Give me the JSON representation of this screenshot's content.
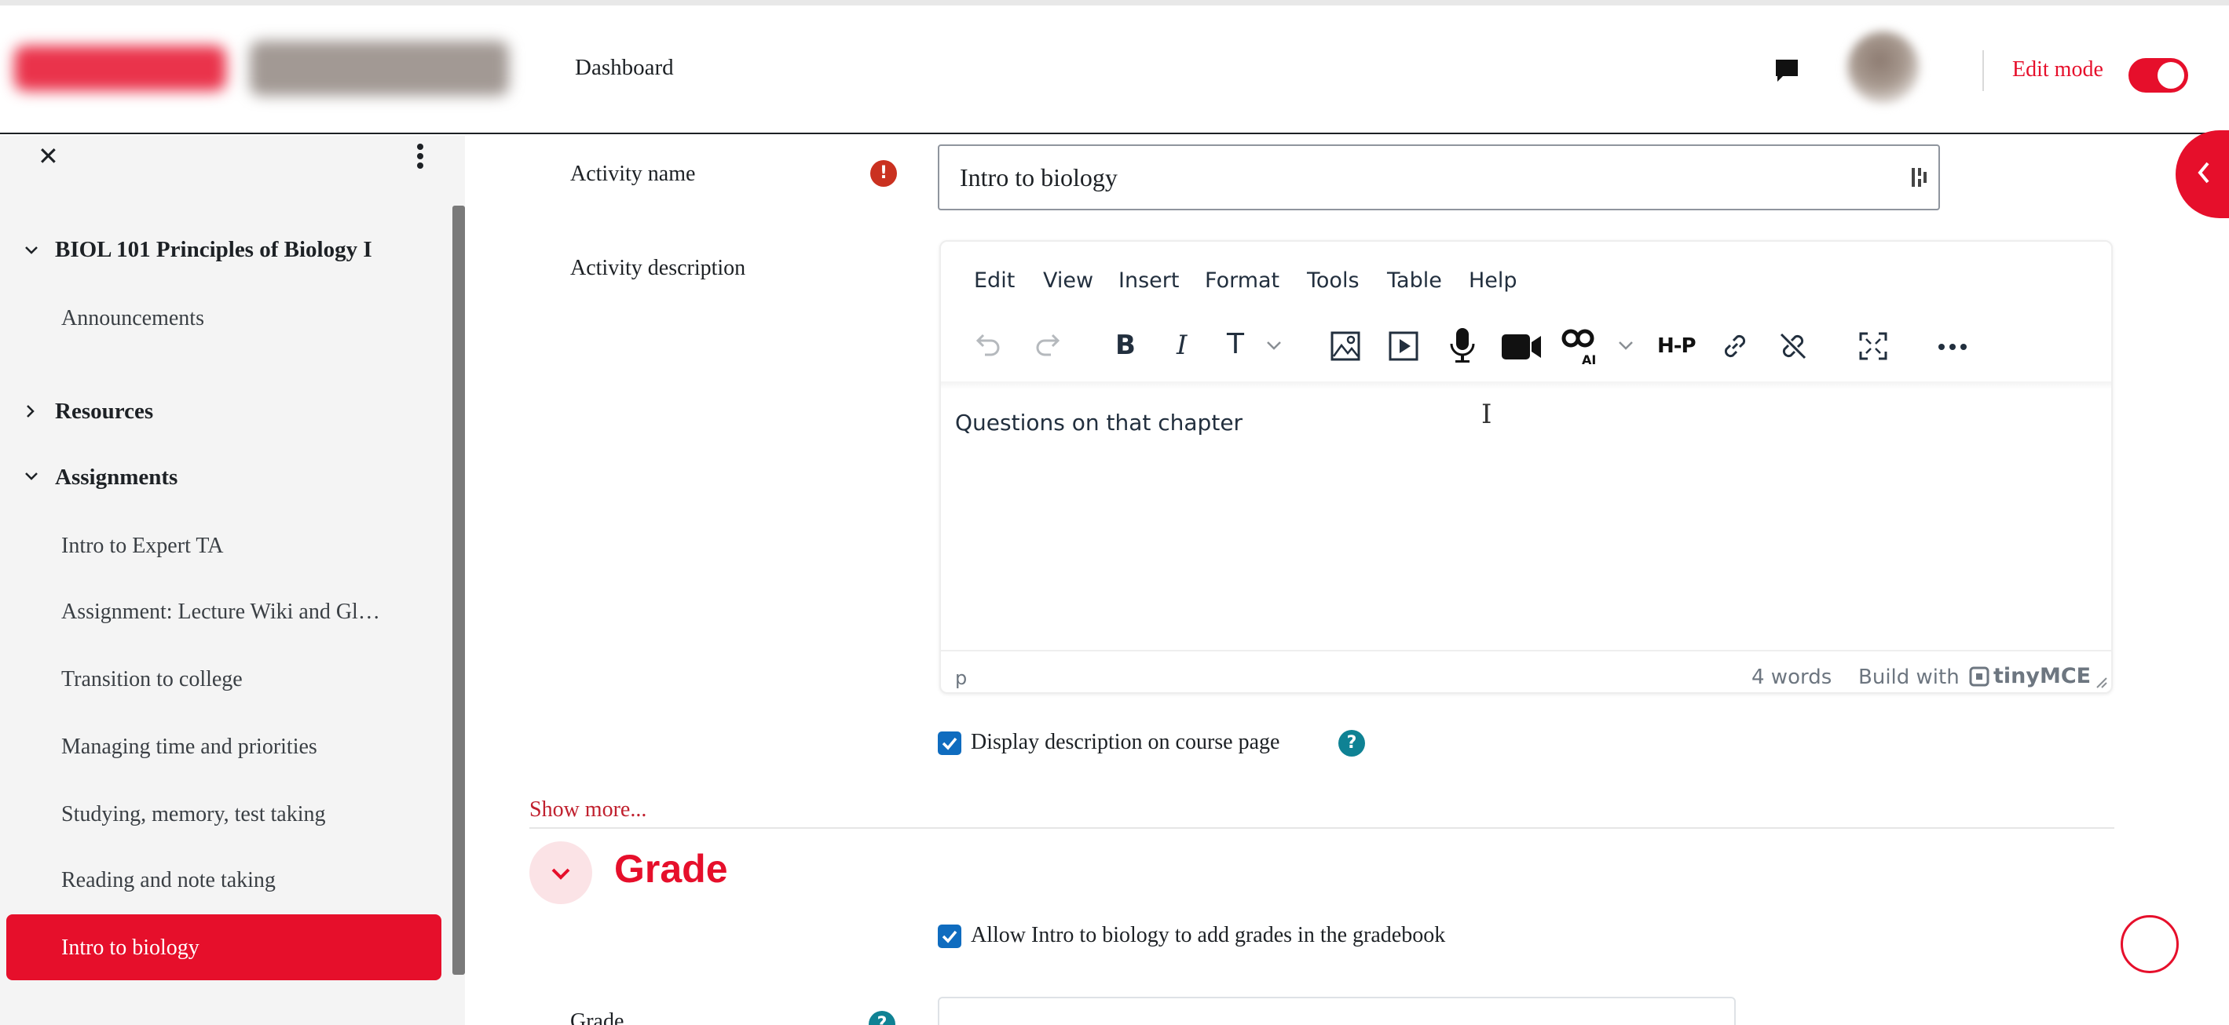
{
  "colors": {
    "brand": "#e60f2b",
    "link": "#c0202e",
    "checkbox": "#0f6cbf",
    "help": "#0f8294",
    "required": "#ca3120"
  },
  "navbar": {
    "dashboard_label": "Dashboard",
    "edit_mode_label": "Edit mode",
    "edit_mode_on": true,
    "icons": [
      "logo",
      "message-icon",
      "avatar"
    ]
  },
  "drawer": {
    "close": "✕",
    "course": "BIOL 101 Principles of Biology I",
    "items": [
      {
        "label": "Announcements"
      },
      {
        "label": "Resources"
      },
      {
        "label": "Assignments"
      },
      {
        "label": "Intro to Expert TA"
      },
      {
        "label": "Assignment: Lecture Wiki and Gl…"
      },
      {
        "label": "Transition to college"
      },
      {
        "label": "Managing time and priorities"
      },
      {
        "label": "Studying, memory, test taking"
      },
      {
        "label": "Reading and note taking"
      },
      {
        "label": "Intro to biology"
      }
    ]
  },
  "form": {
    "activity_name_label": "Activity name",
    "required_mark": "!",
    "activity_name_value": "Intro to biology",
    "activity_description_label": "Activity description",
    "editor": {
      "menu": [
        "Edit",
        "View",
        "Insert",
        "Format",
        "Tools",
        "Table",
        "Help"
      ],
      "content": "Questions on that chapter",
      "path": "p",
      "word_count": "4 words",
      "build_with": "Build with",
      "brand": "tinyMCE",
      "cursor": "I",
      "toolbar_icons": [
        "undo-icon",
        "redo-icon",
        "bold-icon",
        "italic-icon",
        "text-style-icon",
        "image-icon",
        "media-icon",
        "microphone-icon",
        "video-icon",
        "ai-icon",
        "h5p-icon",
        "link-icon",
        "unlink-icon",
        "fullscreen-icon",
        "more-icon"
      ],
      "toolbar_text": {
        "bold": "B",
        "italic": "I",
        "text_style": "T",
        "h5p": "H-P"
      }
    },
    "display_description_label": "Display description on course page",
    "display_description_checked": true,
    "help": "?",
    "show_more": "Show more...",
    "grade_section_title": "Grade",
    "allow_grades_label": "Allow Intro to biology to add grades in the gradebook",
    "allow_grades_checked": true,
    "grade_label": "Grade"
  }
}
